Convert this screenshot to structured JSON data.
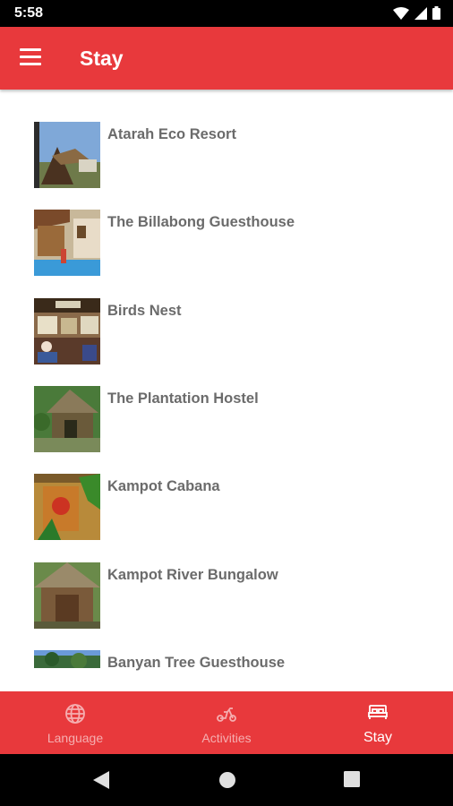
{
  "status_bar": {
    "time": "5:58",
    "icons": [
      "wifi-icon",
      "signal-icon",
      "battery-icon"
    ]
  },
  "app_bar": {
    "title": "Stay",
    "menu_icon": "hamburger-menu-icon"
  },
  "places": [
    {
      "name": "Atarah Eco Resort"
    },
    {
      "name": "The Billabong Guesthouse"
    },
    {
      "name": "Birds Nest"
    },
    {
      "name": "The Plantation Hostel"
    },
    {
      "name": "Kampot Cabana"
    },
    {
      "name": "Kampot River Bungalow"
    },
    {
      "name": "Banyan Tree Guesthouse"
    }
  ],
  "bottom_nav": {
    "items": [
      {
        "label": "Language",
        "icon": "globe-icon"
      },
      {
        "label": "Activities",
        "icon": "scooter-icon"
      },
      {
        "label": "Stay",
        "icon": "bed-icon",
        "active": true
      }
    ]
  },
  "system_nav": [
    "back-button",
    "home-button",
    "recents-button"
  ],
  "colors": {
    "primary": "#e8393c",
    "inactive_label": "#f5aeb0",
    "item_text": "#6b6b6b"
  }
}
